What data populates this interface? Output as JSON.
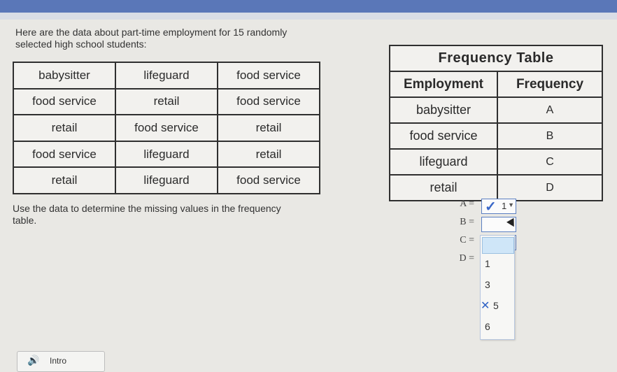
{
  "prompt": {
    "intro": "Here are the data about part-time employment for 15 randomly selected high school students:",
    "instruction": "Use the data to determine the missing values in the frequency table."
  },
  "data_table": {
    "rows": [
      [
        "babysitter",
        "lifeguard",
        "food service"
      ],
      [
        "food service",
        "retail",
        "food service"
      ],
      [
        "retail",
        "food service",
        "retail"
      ],
      [
        "food service",
        "lifeguard",
        "retail"
      ],
      [
        "retail",
        "lifeguard",
        "food service"
      ]
    ]
  },
  "frequency_table": {
    "title": "Frequency Table",
    "headers": [
      "Employment",
      "Frequency"
    ],
    "rows": [
      {
        "employment": "babysitter",
        "frequency": "A"
      },
      {
        "employment": "food service",
        "frequency": "B"
      },
      {
        "employment": "lifeguard",
        "frequency": "C"
      },
      {
        "employment": "retail",
        "frequency": "D"
      }
    ]
  },
  "answers": {
    "rows": [
      {
        "label": "A =",
        "value": "1",
        "checked": true
      },
      {
        "label": "B =",
        "value": ""
      },
      {
        "label": "C =",
        "value": ""
      },
      {
        "label": "D =",
        "value": ""
      }
    ],
    "dropdown_options": [
      "1",
      "3",
      "5",
      "6"
    ],
    "crossed_option": "5",
    "accent_color": "#3967c8"
  },
  "footer": {
    "intro_label": "Intro",
    "icon": "speaker-icon"
  }
}
